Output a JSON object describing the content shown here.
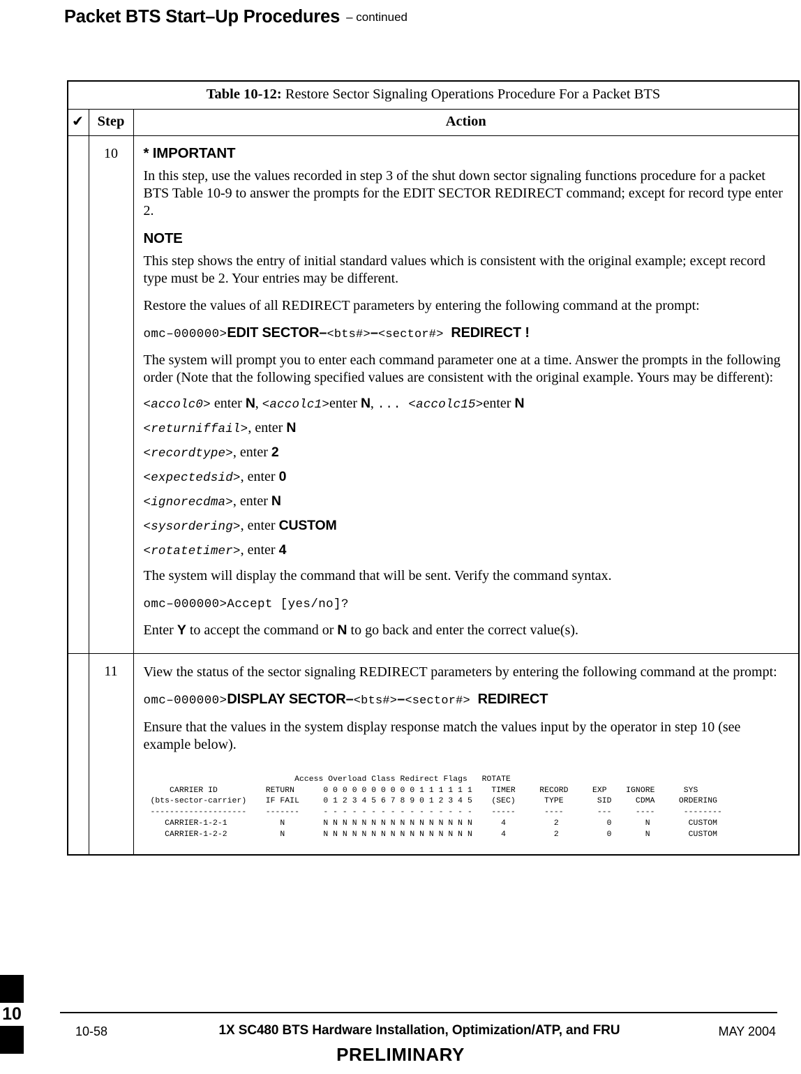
{
  "page_header": {
    "title": "Packet BTS Start–Up Procedures",
    "continued": "– continued"
  },
  "table": {
    "caption_label": "Table 10-12:",
    "caption_text": " Restore Sector Signaling Operations Procedure For a Packet BTS",
    "columns": {
      "check_icon": "✔",
      "step": "Step",
      "action": "Action"
    },
    "rows": [
      {
        "step": "10",
        "important_heading": "* IMPORTANT",
        "important_text": "In this step, use the values recorded in step 3 of the shut down sector signaling functions procedure for a packet BTS Table 10-9 to answer the prompts for the EDIT SECTOR REDIRECT command; except for record type enter 2.",
        "note_heading": "NOTE",
        "note_text": "This step shows the entry of initial standard values which is consistent with the original example; except record type must be 2. Your entries may be different.",
        "intro": "Restore the values of all REDIRECT parameters by entering the following command at the prompt:",
        "command": {
          "prompt": "omc–000000>",
          "verb": "EDIT SECTOR",
          "dash1": "–",
          "arg1": "<bts#>",
          "dash2": "–",
          "arg2": "<sector#>",
          "object": "REDIRECT !"
        },
        "prompt_intro": "The system will prompt you to enter each command parameter one at a time. Answer the prompts in the following order (Note that the following specified values are consistent with the original example. Yours may be different):",
        "params_first_line": {
          "p0": "<accolc0>",
          "enter1": " enter ",
          "v0": "N",
          "sep1": ", ",
          "p1": "<accolc1>",
          "enter2": "enter ",
          "v1": "N",
          "sep2": ", ",
          "dots": "...",
          "p15": "<accolc15>",
          "enter3": "enter ",
          "v15": "N"
        },
        "params": [
          {
            "name": "<returniffail>",
            "enter": ", enter ",
            "value": "N"
          },
          {
            "name": "<recordtype>",
            "enter": ", enter ",
            "value": "2"
          },
          {
            "name": "<expectedsid>",
            "enter": ", enter ",
            "value": "0"
          },
          {
            "name": "<ignorecdma>",
            "enter": ", enter ",
            "value": "N"
          },
          {
            "name": "<sysordering>",
            "enter": ", enter ",
            "value": "CUSTOM"
          },
          {
            "name": "<rotatetimer>",
            "enter": ", enter ",
            "value": "4"
          }
        ],
        "verify_text": "The system will display the command that will be sent. Verify the command syntax.",
        "accept_prompt": "omc–000000>Accept [yes/no]?",
        "accept_pre": "Enter ",
        "accept_yes": "Y",
        "accept_mid": " to accept the command or ",
        "accept_no": "N",
        "accept_post": " to go back and enter the correct value(s)."
      },
      {
        "step": "11",
        "intro": "View the status of the sector signaling REDIRECT parameters by entering the following command at the prompt:",
        "command": {
          "prompt": "omc–000000>",
          "verb": "DISPLAY SECTOR",
          "dash1": "–",
          "arg1": "<bts#>",
          "dash2": "–",
          "arg2": "<sector#>",
          "object": "REDIRECT"
        },
        "ensure_text": "Ensure that the values in the system display response match the values input by the operator in step 10 (see example below).",
        "system_output": "                              Access Overload Class Redirect Flags   ROTATE\n    CARRIER ID          RETURN      0 0 0 0 0 0 0 0 0 0 1 1 1 1 1 1    TIMER     RECORD     EXP    IGNORE      SYS\n(bts-sector-carrier)    IF FAIL     0 1 2 3 4 5 6 7 8 9 0 1 2 3 4 5    (SEC)      TYPE       SID     CDMA     ORDERING\n--------------------    -------     - - - - - - - - - - - - - - - -    -----      ----       ---     ----      --------\n   CARRIER-1-2-1           N        N N N N N N N N N N N N N N N N      4          2          0       N        CUSTOM\n   CARRIER-1-2-2           N        N N N N N N N N N N N N N N N N      4          2          0       N        CUSTOM"
      }
    ]
  },
  "footer": {
    "page_number": "10-58",
    "document_title": "1X SC480 BTS Hardware Installation, Optimization/ATP, and FRU",
    "date": "MAY 2004",
    "status": "PRELIMINARY",
    "chapter_tab": "10"
  }
}
